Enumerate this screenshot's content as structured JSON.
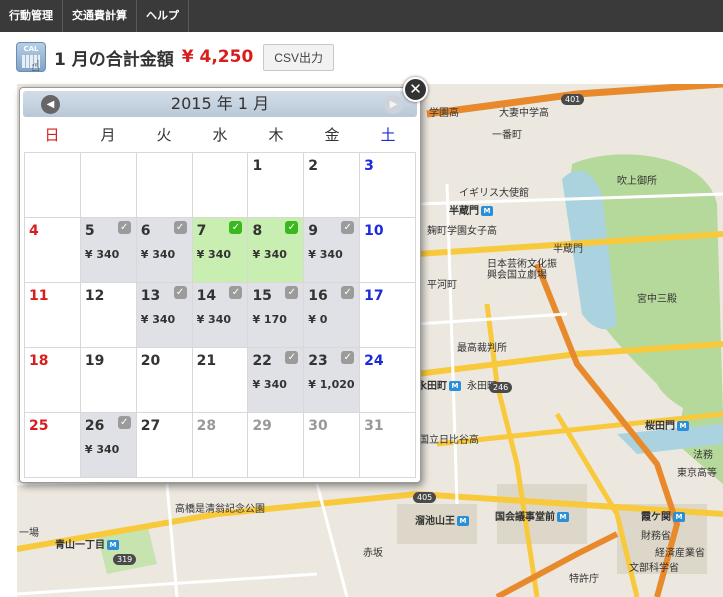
{
  "nav": {
    "items": [
      {
        "name": "nav-item-action-management",
        "label": "行動管理"
      },
      {
        "name": "nav-item-transport-expense",
        "label": "交通費計算"
      },
      {
        "name": "nav-item-help",
        "label": "ヘルプ"
      }
    ]
  },
  "header": {
    "icon_text": "CAL",
    "total_label": "1 月の合計金額",
    "total_amount": "¥ 4,250",
    "csv_button": "CSV出力"
  },
  "calendar": {
    "title": "2015 年 1 月",
    "prev_arrow": "◀",
    "next_arrow": "▶",
    "close": "✕",
    "weekdays": [
      "日",
      "月",
      "火",
      "水",
      "木",
      "金",
      "土"
    ],
    "weeks": [
      [
        {
          "day": "",
          "amount": "",
          "checked": false,
          "state": ""
        },
        {
          "day": "",
          "amount": "",
          "checked": false,
          "state": ""
        },
        {
          "day": "",
          "amount": "",
          "checked": false,
          "state": ""
        },
        {
          "day": "",
          "amount": "",
          "checked": false,
          "state": ""
        },
        {
          "day": "1",
          "amount": "",
          "checked": false,
          "state": ""
        },
        {
          "day": "2",
          "amount": "",
          "checked": false,
          "state": ""
        },
        {
          "day": "3",
          "amount": "",
          "checked": false,
          "state": ""
        }
      ],
      [
        {
          "day": "4",
          "amount": "",
          "checked": false,
          "state": ""
        },
        {
          "day": "5",
          "amount": "¥ 340",
          "checked": true,
          "state": "has-amount"
        },
        {
          "day": "6",
          "amount": "¥ 340",
          "checked": true,
          "state": "has-amount"
        },
        {
          "day": "7",
          "amount": "¥ 340",
          "checked": true,
          "state": "highlight"
        },
        {
          "day": "8",
          "amount": "¥ 340",
          "checked": true,
          "state": "highlight"
        },
        {
          "day": "9",
          "amount": "¥ 340",
          "checked": true,
          "state": "has-amount"
        },
        {
          "day": "10",
          "amount": "",
          "checked": false,
          "state": ""
        }
      ],
      [
        {
          "day": "11",
          "amount": "",
          "checked": false,
          "state": ""
        },
        {
          "day": "12",
          "amount": "",
          "checked": false,
          "state": ""
        },
        {
          "day": "13",
          "amount": "¥ 340",
          "checked": true,
          "state": "has-amount"
        },
        {
          "day": "14",
          "amount": "¥ 340",
          "checked": true,
          "state": "has-amount"
        },
        {
          "day": "15",
          "amount": "¥ 170",
          "checked": true,
          "state": "has-amount"
        },
        {
          "day": "16",
          "amount": "¥ 0",
          "checked": true,
          "state": "has-amount"
        },
        {
          "day": "17",
          "amount": "",
          "checked": false,
          "state": ""
        }
      ],
      [
        {
          "day": "18",
          "amount": "",
          "checked": false,
          "state": ""
        },
        {
          "day": "19",
          "amount": "",
          "checked": false,
          "state": ""
        },
        {
          "day": "20",
          "amount": "",
          "checked": false,
          "state": ""
        },
        {
          "day": "21",
          "amount": "",
          "checked": false,
          "state": ""
        },
        {
          "day": "22",
          "amount": "¥ 340",
          "checked": true,
          "state": "has-amount"
        },
        {
          "day": "23",
          "amount": "¥ 1,020",
          "checked": true,
          "state": "has-amount"
        },
        {
          "day": "24",
          "amount": "",
          "checked": false,
          "state": ""
        }
      ],
      [
        {
          "day": "25",
          "amount": "",
          "checked": false,
          "state": ""
        },
        {
          "day": "26",
          "amount": "¥ 340",
          "checked": true,
          "state": "has-amount"
        },
        {
          "day": "27",
          "amount": "",
          "checked": false,
          "state": ""
        },
        {
          "day": "28",
          "amount": "",
          "checked": false,
          "state": "next-month"
        },
        {
          "day": "29",
          "amount": "",
          "checked": false,
          "state": "next-month"
        },
        {
          "day": "30",
          "amount": "",
          "checked": false,
          "state": "next-month"
        },
        {
          "day": "31",
          "amount": "",
          "checked": false,
          "state": "next-month"
        }
      ]
    ]
  },
  "map": {
    "labels": [
      "大妻中学高",
      "学園高",
      "一番町",
      "イギリス大使館",
      "半蔵門",
      "麹町学園女子高",
      "吹上御所",
      "半蔵門",
      "日本芸術文化振興会国立劇場",
      "平河町",
      "宮中三殿",
      "最高裁判所",
      "永田町",
      "永田町",
      "国立日比谷高",
      "桜田門",
      "法務",
      "東京高等",
      "国会議事堂前",
      "霞ケ関",
      "財務省",
      "経済産業省",
      "文部科学省",
      "溜池山王",
      "赤坂",
      "高橋是清翁記念公園",
      "青山一丁目",
      "特許庁",
      "一場"
    ],
    "roads": [
      "401",
      "246",
      "405",
      "319"
    ]
  },
  "colors": {
    "nav_bg": "#3a3a3a",
    "total_red": "#d81d1d",
    "weekend_sun": "#d81d1d",
    "weekend_sat": "#1d2ad8",
    "cell_amount_bg": "#dfe1e6",
    "cell_highlight_bg": "#c8efb1",
    "check_gray": "#9b9b9b",
    "check_green": "#3cb81f"
  }
}
